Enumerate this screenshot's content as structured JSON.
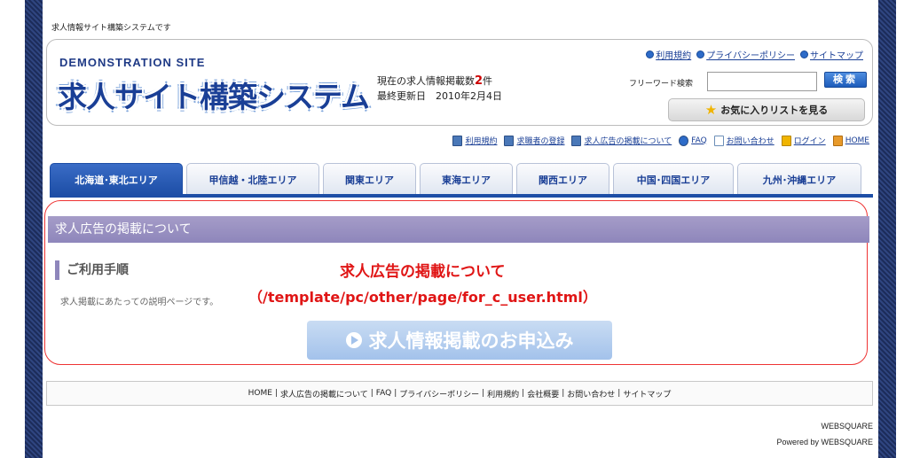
{
  "tagline": "求人情報サイト構築システムです",
  "header": {
    "demo_label": "DEMONSTRATION SITE",
    "logo": "求人サイト構築システム",
    "job_count_prefix": "現在の求人情報掲載数",
    "job_count_num": "2",
    "job_count_suffix": "件",
    "last_updated": "最終更新日　2010年2月4日",
    "top_links": [
      "利用規約",
      "プライバシーポリシー",
      "サイトマップ"
    ],
    "search_label": "フリーワード検索",
    "search_value": "",
    "search_button": "検索",
    "favorites_button": "お気に入りリストを見る"
  },
  "util_nav": [
    "利用規約",
    "求職者の登録",
    "求人広告の掲載について",
    "FAQ",
    "お問い合わせ",
    "ログイン",
    "HOME"
  ],
  "tabs": [
    "北海道･東北エリア",
    "甲信越・北陸エリア",
    "関東エリア",
    "東海エリア",
    "関西エリア",
    "中国･四国エリア",
    "九州･沖縄エリア"
  ],
  "content": {
    "section_title": "求人広告の掲載について",
    "sub_heading": "ご利用手順",
    "description": "求人掲載にあたっての説明ページです。",
    "overlay_title": "求人広告の掲載について",
    "overlay_path": "（/template/pc/other/page/for_c_user.html）",
    "apply_button": "求人情報掲載のお申込み"
  },
  "footer": {
    "links": [
      "HOME",
      "求人広告の掲載について",
      "FAQ",
      "プライバシーポリシー",
      "利用規約",
      "会社概要",
      "お問い合わせ",
      "サイトマップ"
    ],
    "credit_1": "WEBSQUARE",
    "credit_2": "Powered by WEBSQUARE"
  },
  "colors": {
    "brand_blue": "#1a3f96",
    "tab_active": "#1d4ea6",
    "section_bar": "#8e86bb",
    "overlay_red": "#e01515"
  }
}
